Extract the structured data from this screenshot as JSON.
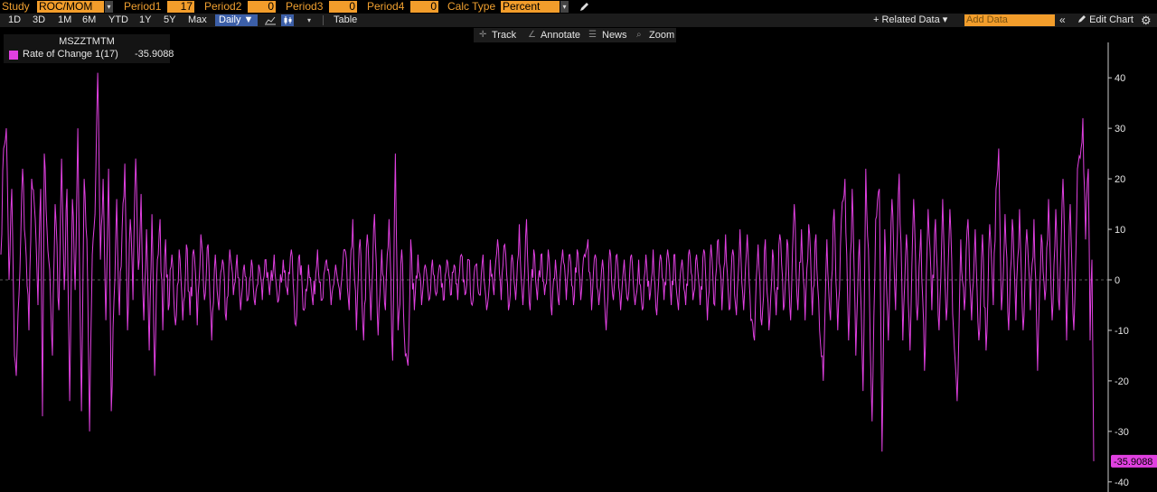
{
  "toolbar": {
    "study_label": "Study",
    "study_value": "ROC/MOM",
    "period1_label": "Period1",
    "period1_value": "17",
    "period2_label": "Period2",
    "period2_value": "0",
    "period3_label": "Period3",
    "period3_value": "0",
    "period4_label": "Period4",
    "period4_value": "0",
    "calc_type_label": "Calc Type",
    "calc_type_value": "Percent"
  },
  "range_bar": {
    "ranges": [
      "1D",
      "3D",
      "1M",
      "6M",
      "YTD",
      "1Y",
      "5Y",
      "Max"
    ],
    "frequency": "Daily ▼",
    "table_label": "Table",
    "related_data": "+ Related Data ▾",
    "add_data_placeholder": "Add Data",
    "collapse": "«",
    "edit_chart": "Edit Chart",
    "gear": "⚙"
  },
  "chart_tools": {
    "track": "Track",
    "annotate": "Annotate",
    "news": "News",
    "zoom": "Zoom"
  },
  "legend": {
    "ticker": "MSZZTMTM",
    "series_name": "Rate of Change 1(17)",
    "series_value": "-35.9088"
  },
  "colors": {
    "series": "#e040e0",
    "field": "#f29d2b",
    "background": "#000000"
  },
  "chart_data": {
    "type": "line",
    "ylim": [
      -42,
      47
    ],
    "yticks": [
      40,
      30,
      20,
      10,
      0,
      -10,
      -20,
      -30,
      -40
    ],
    "zero_line": "dashed",
    "last_value_label": "-35.9088",
    "n_points": 1000,
    "anchors": [
      [
        0,
        5
      ],
      [
        3,
        26
      ],
      [
        6,
        30
      ],
      [
        9,
        0
      ],
      [
        12,
        18
      ],
      [
        15,
        -15
      ],
      [
        17,
        -19
      ],
      [
        20,
        -3
      ],
      [
        24,
        22
      ],
      [
        27,
        8
      ],
      [
        31,
        -10
      ],
      [
        34,
        20
      ],
      [
        38,
        12
      ],
      [
        41,
        -5
      ],
      [
        44,
        18
      ],
      [
        46,
        -27
      ],
      [
        48,
        25
      ],
      [
        51,
        10
      ],
      [
        54,
        2
      ],
      [
        57,
        -15
      ],
      [
        60,
        15
      ],
      [
        64,
        -6
      ],
      [
        67,
        24
      ],
      [
        70,
        -2
      ],
      [
        73,
        18
      ],
      [
        76,
        -24
      ],
      [
        79,
        16
      ],
      [
        82,
        -2
      ],
      [
        85,
        30
      ],
      [
        89,
        -26
      ],
      [
        92,
        20
      ],
      [
        95,
        8
      ],
      [
        98,
        -30
      ],
      [
        101,
        5
      ],
      [
        104,
        13
      ],
      [
        107,
        41
      ],
      [
        110,
        4
      ],
      [
        113,
        20
      ],
      [
        116,
        -8
      ],
      [
        119,
        22
      ],
      [
        122,
        -26
      ],
      [
        125,
        -4
      ],
      [
        128,
        16
      ],
      [
        131,
        -7
      ],
      [
        134,
        10
      ],
      [
        137,
        23
      ],
      [
        140,
        -10
      ],
      [
        143,
        12
      ],
      [
        146,
        -4
      ],
      [
        149,
        24
      ],
      [
        152,
        2
      ],
      [
        155,
        17
      ],
      [
        158,
        -8
      ],
      [
        161,
        10
      ],
      [
        164,
        -14
      ],
      [
        167,
        13
      ],
      [
        170,
        -19
      ],
      [
        173,
        4
      ],
      [
        176,
        12
      ],
      [
        179,
        -10
      ],
      [
        182,
        8
      ],
      [
        185,
        -6
      ],
      [
        189,
        5
      ],
      [
        193,
        -9
      ],
      [
        197,
        6
      ],
      [
        201,
        -8
      ],
      [
        205,
        7
      ],
      [
        209,
        -7
      ],
      [
        213,
        6
      ],
      [
        217,
        -9
      ],
      [
        221,
        9
      ],
      [
        225,
        -4
      ],
      [
        229,
        7
      ],
      [
        233,
        -12
      ],
      [
        237,
        5
      ],
      [
        241,
        -6
      ],
      [
        245,
        4
      ],
      [
        249,
        -8
      ],
      [
        253,
        6
      ],
      [
        257,
        -3
      ],
      [
        261,
        5
      ],
      [
        265,
        -6
      ],
      [
        269,
        3
      ],
      [
        273,
        -4
      ],
      [
        277,
        4
      ],
      [
        281,
        -5
      ],
      [
        285,
        3
      ],
      [
        289,
        -4
      ],
      [
        293,
        4
      ],
      [
        297,
        -3
      ],
      [
        302,
        5
      ],
      [
        307,
        -4
      ],
      [
        312,
        4
      ],
      [
        317,
        -3
      ],
      [
        321,
        6
      ],
      [
        326,
        -9
      ],
      [
        330,
        5
      ],
      [
        335,
        -6
      ],
      [
        340,
        3
      ],
      [
        345,
        -5
      ],
      [
        350,
        6
      ],
      [
        355,
        -4
      ],
      [
        360,
        4
      ],
      [
        365,
        -5
      ],
      [
        370,
        3
      ],
      [
        375,
        -4
      ],
      [
        380,
        6
      ],
      [
        385,
        -6
      ],
      [
        389,
        12
      ],
      [
        393,
        -10
      ],
      [
        397,
        8
      ],
      [
        401,
        -12
      ],
      [
        405,
        9
      ],
      [
        409,
        -8
      ],
      [
        413,
        13
      ],
      [
        417,
        -11
      ],
      [
        421,
        6
      ],
      [
        425,
        -6
      ],
      [
        429,
        12
      ],
      [
        433,
        -16
      ],
      [
        436,
        25
      ],
      [
        439,
        -10
      ],
      [
        443,
        6
      ],
      [
        447,
        -15
      ],
      [
        450,
        -17
      ],
      [
        453,
        8
      ],
      [
        457,
        -6
      ],
      [
        461,
        5
      ],
      [
        465,
        -5
      ],
      [
        469,
        3
      ],
      [
        473,
        -4
      ],
      [
        477,
        4
      ],
      [
        481,
        -3
      ],
      [
        485,
        3
      ],
      [
        489,
        -4
      ],
      [
        493,
        4
      ],
      [
        497,
        -3
      ],
      [
        501,
        3
      ],
      [
        505,
        -4
      ],
      [
        509,
        5
      ],
      [
        513,
        -3
      ],
      [
        517,
        4
      ],
      [
        521,
        -5
      ],
      [
        525,
        3
      ],
      [
        529,
        -3
      ],
      [
        533,
        5
      ],
      [
        537,
        -6
      ],
      [
        541,
        4
      ],
      [
        545,
        -3
      ],
      [
        549,
        8
      ],
      [
        553,
        -4
      ],
      [
        557,
        7
      ],
      [
        561,
        -6
      ],
      [
        565,
        5
      ],
      [
        569,
        -4
      ],
      [
        573,
        11
      ],
      [
        577,
        -5
      ],
      [
        581,
        12
      ],
      [
        585,
        -6
      ],
      [
        589,
        6
      ],
      [
        593,
        -4
      ],
      [
        597,
        5
      ],
      [
        601,
        -3
      ],
      [
        605,
        6
      ],
      [
        609,
        -7
      ],
      [
        613,
        4
      ],
      [
        617,
        -5
      ],
      [
        621,
        6
      ],
      [
        625,
        -4
      ],
      [
        629,
        5
      ],
      [
        633,
        -5
      ],
      [
        637,
        6
      ],
      [
        641,
        -4
      ],
      [
        645,
        5
      ],
      [
        649,
        8
      ],
      [
        653,
        -6
      ],
      [
        657,
        5
      ],
      [
        661,
        -5
      ],
      [
        665,
        4
      ],
      [
        669,
        -10
      ],
      [
        673,
        6
      ],
      [
        677,
        -4
      ],
      [
        681,
        5
      ],
      [
        685,
        -6
      ],
      [
        689,
        4
      ],
      [
        693,
        -4
      ],
      [
        697,
        5
      ],
      [
        701,
        -5
      ],
      [
        705,
        4
      ],
      [
        709,
        -6
      ],
      [
        713,
        5
      ],
      [
        717,
        -4
      ],
      [
        721,
        6
      ],
      [
        725,
        -7
      ],
      [
        729,
        5
      ],
      [
        733,
        -4
      ],
      [
        737,
        6
      ],
      [
        741,
        -5
      ],
      [
        745,
        5
      ],
      [
        749,
        -6
      ],
      [
        753,
        4
      ],
      [
        757,
        -5
      ],
      [
        761,
        6
      ],
      [
        765,
        -4
      ],
      [
        769,
        5
      ],
      [
        773,
        -5
      ],
      [
        777,
        6
      ],
      [
        781,
        -8
      ],
      [
        785,
        7
      ],
      [
        789,
        -5
      ],
      [
        793,
        8
      ],
      [
        797,
        -6
      ],
      [
        801,
        9
      ],
      [
        805,
        -6
      ],
      [
        809,
        6
      ],
      [
        813,
        -7
      ],
      [
        817,
        10
      ],
      [
        821,
        -6
      ],
      [
        825,
        9
      ],
      [
        829,
        -8
      ],
      [
        833,
        -12
      ],
      [
        837,
        7
      ],
      [
        841,
        -9
      ],
      [
        845,
        8
      ],
      [
        849,
        -10
      ],
      [
        853,
        6
      ],
      [
        857,
        -7
      ],
      [
        861,
        9
      ],
      [
        865,
        -6
      ],
      [
        869,
        8
      ],
      [
        873,
        -8
      ],
      [
        877,
        15
      ],
      [
        881,
        -6
      ],
      [
        885,
        10
      ],
      [
        889,
        -8
      ],
      [
        893,
        11
      ],
      [
        897,
        -7
      ],
      [
        901,
        9
      ],
      [
        905,
        -10
      ],
      [
        909,
        -20
      ],
      [
        913,
        8
      ],
      [
        917,
        -8
      ],
      [
        921,
        14
      ],
      [
        925,
        -10
      ],
      [
        929,
        12
      ],
      [
        933,
        20
      ],
      [
        937,
        -12
      ],
      [
        941,
        18
      ],
      [
        945,
        -15
      ],
      [
        949,
        8
      ],
      [
        953,
        -22
      ],
      [
        956,
        22
      ],
      [
        959,
        6
      ],
      [
        963,
        -28
      ],
      [
        967,
        12
      ],
      [
        971,
        18
      ],
      [
        974,
        -34
      ],
      [
        977,
        10
      ],
      [
        981,
        -12
      ],
      [
        985,
        16
      ],
      [
        989,
        -6
      ],
      [
        993,
        21
      ],
      [
        997,
        -12
      ],
      [
        1001,
        9
      ],
      [
        1005,
        -14
      ],
      [
        1009,
        16
      ],
      [
        1013,
        -8
      ],
      [
        1017,
        10
      ],
      [
        1021,
        -18
      ],
      [
        1025,
        14
      ],
      [
        1029,
        -6
      ],
      [
        1033,
        12
      ],
      [
        1037,
        -10
      ],
      [
        1041,
        16
      ],
      [
        1045,
        -8
      ],
      [
        1049,
        14
      ],
      [
        1053,
        -10
      ],
      [
        1057,
        -24
      ],
      [
        1061,
        8
      ],
      [
        1065,
        -6
      ],
      [
        1069,
        12
      ],
      [
        1073,
        -8
      ],
      [
        1077,
        10
      ],
      [
        1081,
        -12
      ],
      [
        1085,
        9
      ],
      [
        1089,
        -14
      ],
      [
        1093,
        11
      ],
      [
        1097,
        -5
      ],
      [
        1100,
        18
      ],
      [
        1103,
        26
      ],
      [
        1106,
        -6
      ],
      [
        1110,
        13
      ],
      [
        1114,
        -10
      ],
      [
        1118,
        12
      ],
      [
        1122,
        -8
      ],
      [
        1126,
        14
      ],
      [
        1130,
        -10
      ],
      [
        1134,
        10
      ],
      [
        1138,
        -6
      ],
      [
        1142,
        12
      ],
      [
        1146,
        -18
      ],
      [
        1150,
        9
      ],
      [
        1154,
        -4
      ],
      [
        1158,
        16
      ],
      [
        1162,
        -8
      ],
      [
        1166,
        14
      ],
      [
        1170,
        -6
      ],
      [
        1174,
        20
      ],
      [
        1178,
        -12
      ],
      [
        1182,
        15
      ],
      [
        1186,
        -10
      ],
      [
        1190,
        22
      ],
      [
        1194,
        26
      ],
      [
        1196,
        32
      ],
      [
        1199,
        8
      ],
      [
        1202,
        22
      ],
      [
        1204,
        -12
      ],
      [
        1206,
        4
      ],
      [
        1208,
        -35.9088
      ]
    ]
  }
}
